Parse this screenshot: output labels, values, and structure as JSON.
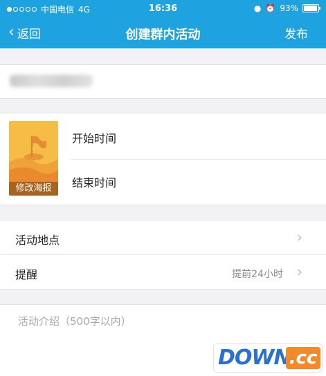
{
  "status_bar": {
    "carrier": "中国电信",
    "network": "4G",
    "time": "16:36",
    "battery": "93%",
    "battery_level": 0.93
  },
  "nav": {
    "back_label": "返回",
    "title": "创建群内活动",
    "publish_label": "发布"
  },
  "poster": {
    "label": "修改海报"
  },
  "time": {
    "start_label": "开始时间",
    "end_label": "结束时间"
  },
  "details": {
    "location_label": "活动地点",
    "reminder_label": "提醒",
    "reminder_value": "提前24小时"
  },
  "description": {
    "placeholder": "活动介绍（500字以内）"
  },
  "watermark": {
    "text_main": "DOWN",
    "text_suffix": ".cc"
  },
  "colors": {
    "accent": "#1fa3e0",
    "poster": "#f1a53a"
  }
}
